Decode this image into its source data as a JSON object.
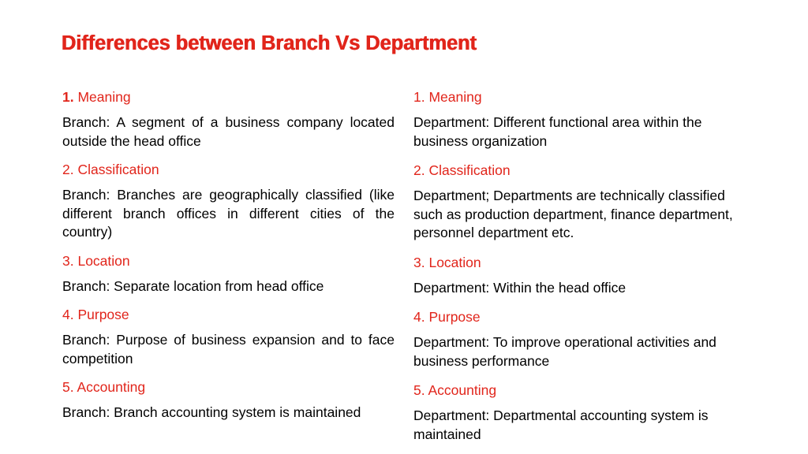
{
  "slide": {
    "title": "Differences between Branch Vs Department",
    "background_color": "#FFFFFF",
    "accent_color": "#E1251B",
    "body_color": "#000000"
  },
  "left_column": {
    "items": [
      {
        "number": "1.",
        "heading": "Meaning",
        "heading_full": "1. Meaning",
        "body": "Branch: A segment of a business company located outside the head office"
      },
      {
        "number": "2.",
        "heading": "Classification",
        "heading_full": "2. Classification",
        "body": "Branch: Branches are geographically classified (like different branch offices in different cities of the country)"
      },
      {
        "number": "3.",
        "heading": "Location",
        "heading_full": "3. Location",
        "body": "Branch: Separate location from head office"
      },
      {
        "number": "4.",
        "heading": "Purpose",
        "heading_full": "4. Purpose",
        "body": "Branch: Purpose of business expansion and to face competition"
      },
      {
        "number": "5.",
        "heading": "Accounting",
        "heading_full": "5. Accounting",
        "body": "Branch: Branch accounting system is maintained"
      }
    ]
  },
  "right_column": {
    "items": [
      {
        "number": "1.",
        "heading": "Meaning",
        "heading_full": "1. Meaning",
        "body": "Department: Different functional area within the business organization"
      },
      {
        "number": "2.",
        "heading": "Classification",
        "heading_full": "2. Classification",
        "body": "Department; Departments are technically classified such as production department, finance department, personnel department etc."
      },
      {
        "number": "3.",
        "heading": "Location",
        "heading_full": "3. Location",
        "body": "Department: Within the head office"
      },
      {
        "number": "4.",
        "heading": "Purpose",
        "heading_full": "4. Purpose",
        "body": "Department: To improve operational activities and business performance"
      },
      {
        "number": "5.",
        "heading": "Accounting",
        "heading_full": "5. Accounting",
        "body": "Department: Departmental accounting system is maintained"
      }
    ]
  }
}
